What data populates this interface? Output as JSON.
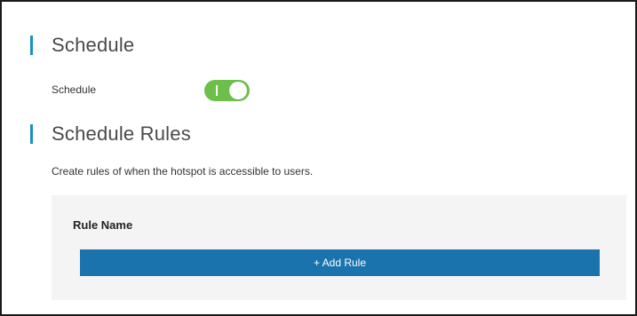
{
  "schedule": {
    "heading": "Schedule",
    "toggle_label": "Schedule",
    "toggle_on": true
  },
  "rules": {
    "heading": "Schedule Rules",
    "description": "Create rules of when the hotspot is accessible to users.",
    "column_header": "Rule Name",
    "add_button_label": "+ Add Rule"
  },
  "colors": {
    "accent": "#1a8fc7",
    "toggle_on": "#6cc04a",
    "button": "#1b73ad"
  }
}
